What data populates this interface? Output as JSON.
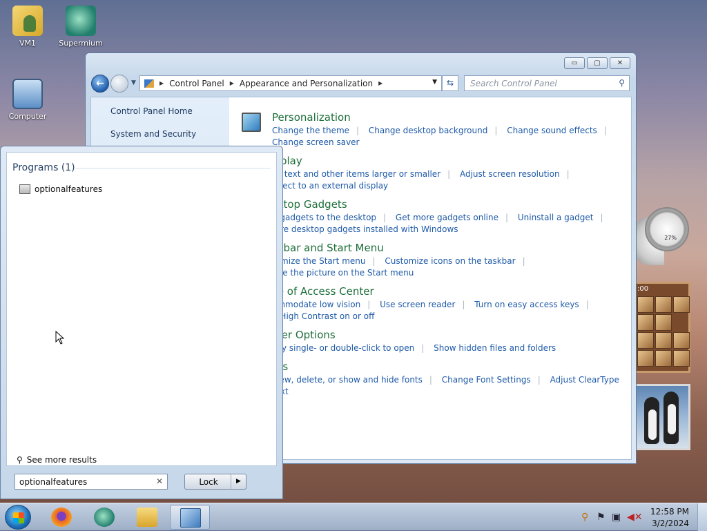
{
  "desktop": {
    "icons": [
      {
        "label": "VM1"
      },
      {
        "label": "Supermium"
      },
      {
        "label": "Computer"
      }
    ],
    "gadget_meter_pct": "27%",
    "gadget_clock": ":00"
  },
  "control_panel": {
    "window_buttons": {
      "minimize": "▭",
      "maximize": "▢",
      "close": "✕"
    },
    "breadcrumb": [
      "Control Panel",
      "Appearance and Personalization"
    ],
    "search_placeholder": "Search Control Panel",
    "sidebar": [
      {
        "label": "Control Panel Home"
      },
      {
        "label": "System and Security"
      }
    ],
    "categories": [
      {
        "title": "Personalization",
        "links": [
          "Change the theme",
          "Change desktop background",
          "Change sound effects",
          "Change screen saver"
        ]
      },
      {
        "title": "isplay",
        "links": [
          "ke text and other items larger or smaller",
          "Adjust screen resolution",
          "nnect to an external display"
        ]
      },
      {
        "title": "sktop Gadgets",
        "links": [
          "d gadgets to the desktop",
          "Get more gadgets online",
          "Uninstall a gadget",
          "tore desktop gadgets installed with Windows"
        ]
      },
      {
        "title": "skbar and Start Menu",
        "links": [
          "tomize the Start menu",
          "Customize icons on the taskbar",
          "nge the picture on the Start menu"
        ]
      },
      {
        "title": "se of Access Center",
        "links": [
          "ommodate low vision",
          "Use screen reader",
          "Turn on easy access keys",
          "n High Contrast on or off"
        ]
      },
      {
        "title": "lder Options",
        "links": [
          "cify single- or double-click to open",
          "Show hidden files and folders"
        ]
      },
      {
        "title": "nts",
        "links": [
          "view, delete, or show and hide fonts",
          "Change Font Settings",
          "Adjust ClearType text"
        ]
      }
    ]
  },
  "start_menu": {
    "programs_header": "Programs (1)",
    "program_item": "optionalfeatures",
    "see_more": "See more results",
    "search_value": "optionalfeatures",
    "clear_glyph": "✕",
    "lock_label": "Lock",
    "lock_arrow": "▶"
  },
  "taskbar": {
    "time": "12:58 PM",
    "date": "3/2/2024"
  },
  "colors": {
    "link": "#1e5aa8",
    "category_title": "#1e6f3b"
  }
}
